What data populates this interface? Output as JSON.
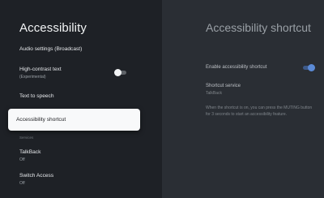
{
  "left": {
    "title": "Accessibility",
    "items": [
      {
        "label": "Audio settings (Broadcast)"
      },
      {
        "label": "High-contrast text",
        "sub": "(Experimental)",
        "toggle": "off"
      },
      {
        "label": "Text to speech"
      },
      {
        "label": "Accessibility shortcut",
        "focused": true
      },
      {
        "partial": "Services"
      },
      {
        "label": "TalkBack",
        "sub": "Off"
      },
      {
        "label": "Switch Access",
        "sub": "Off"
      }
    ]
  },
  "right": {
    "title": "Accessibility shortcut",
    "enable_label": "Enable accessibility shortcut",
    "enable_state": "on",
    "service_label": "Shortcut service",
    "service_value": "TalkBack",
    "description": "When the shortcut is on, you can press the MUTING button for 3 seconds to start an accessibility feature."
  },
  "colors": {
    "accent": "#5b8ad6",
    "focus_bg": "#f8f9fa",
    "background": "#1c1f24",
    "panel": "#2a2e34"
  }
}
